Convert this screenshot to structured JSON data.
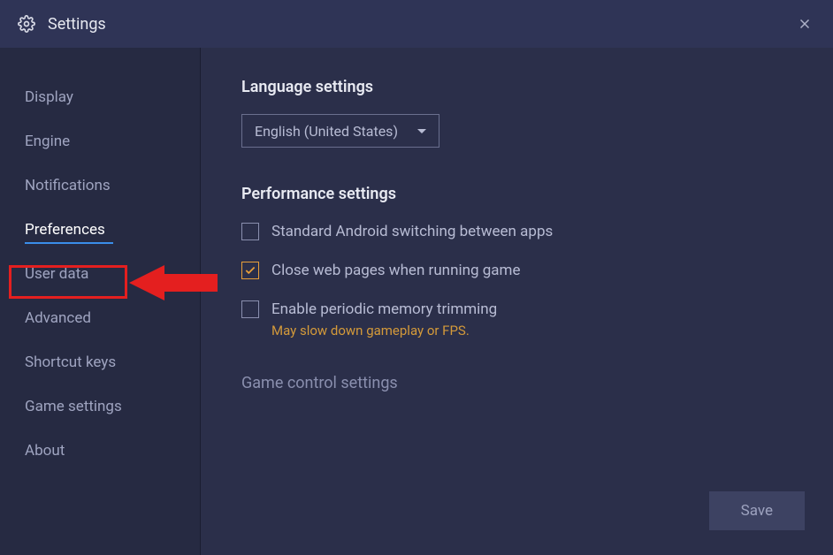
{
  "titlebar": {
    "title": "Settings"
  },
  "sidebar": {
    "items": [
      {
        "label": "Display"
      },
      {
        "label": "Engine"
      },
      {
        "label": "Notifications"
      },
      {
        "label": "Preferences",
        "active": true
      },
      {
        "label": "User data"
      },
      {
        "label": "Advanced"
      },
      {
        "label": "Shortcut keys"
      },
      {
        "label": "Game settings"
      },
      {
        "label": "About"
      }
    ]
  },
  "main": {
    "language_heading": "Language settings",
    "language_value": "English (United States)",
    "performance_heading": "Performance settings",
    "checkboxes": [
      {
        "label": "Standard Android switching between apps",
        "checked": false
      },
      {
        "label": "Close web pages when running game",
        "checked": true
      },
      {
        "label": "Enable periodic memory trimming",
        "checked": false,
        "warning": "May slow down gameplay or FPS."
      }
    ],
    "game_control_heading": "Game control settings",
    "save_label": "Save"
  }
}
